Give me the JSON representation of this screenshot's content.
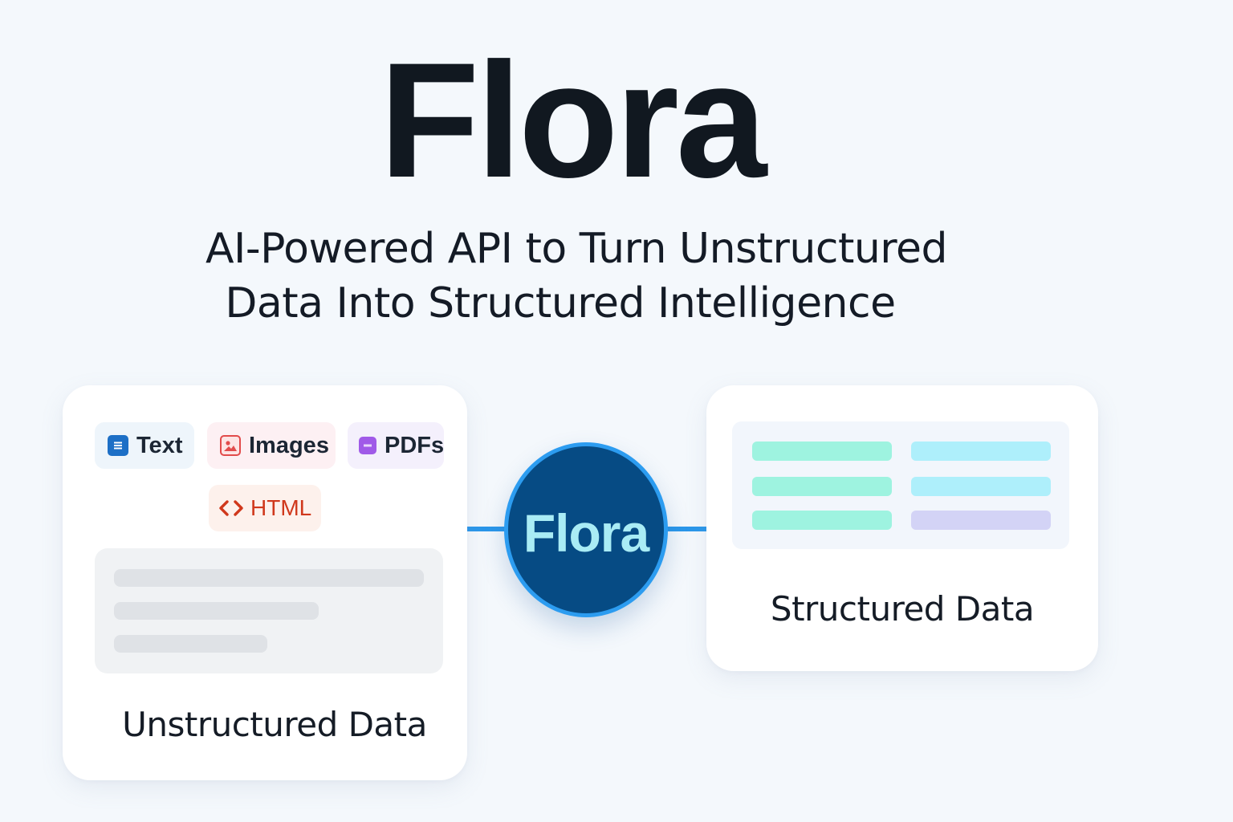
{
  "header": {
    "title": "Flora",
    "subtitle_line1": "AI-Powered API to Turn Unstructured",
    "subtitle_line2": "Data Into Structured Intelligence"
  },
  "input_card": {
    "chips": [
      {
        "label": "Text",
        "icon": "document-lines-icon",
        "color": "#1d6fc6"
      },
      {
        "label": "Images",
        "icon": "image-icon",
        "color": "#e24b4b"
      },
      {
        "label": "PDFs",
        "icon": "pdf-icon",
        "color": "#a05ae8"
      },
      {
        "label": "HTML",
        "icon": "code-brackets-icon",
        "color": "#d0381c"
      }
    ],
    "label": "Unstructured Data"
  },
  "hub": {
    "label": "Flora",
    "fill_color": "#064b84",
    "ring_color": "#2c9cf0",
    "text_color": "#a9ecf5"
  },
  "output_card": {
    "label": "Structured Data",
    "cell_colors": [
      "#9ef3e0",
      "#aeeffb",
      "#9ef3e0",
      "#aeeffb",
      "#9ef3e0",
      "#d3d3f6"
    ]
  },
  "connector_color": "#2b97ea"
}
